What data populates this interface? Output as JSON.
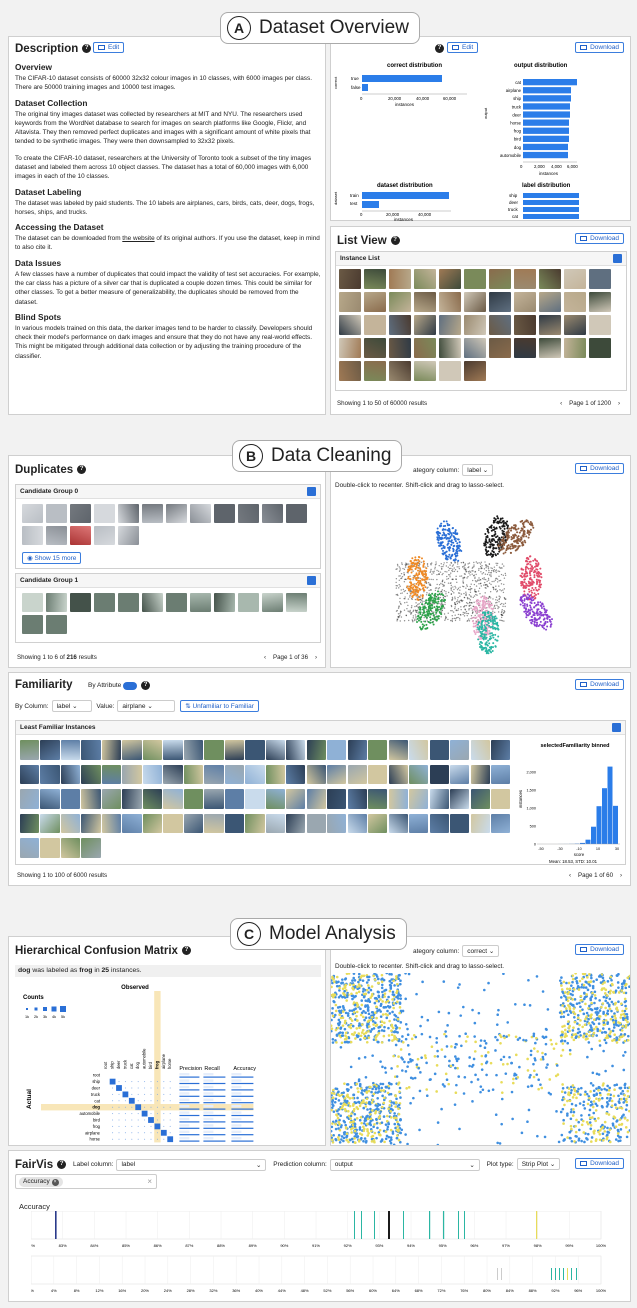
{
  "sections": {
    "a": {
      "letter": "A",
      "title": "Dataset Overview"
    },
    "b": {
      "letter": "B",
      "title": "Data Cleaning"
    },
    "c": {
      "letter": "C",
      "title": "Model Analysis"
    }
  },
  "common": {
    "edit": "Edit",
    "download": "Download",
    "help": "?"
  },
  "description": {
    "title": "Description",
    "overview_h": "Overview",
    "overview": "The CIFAR-10 dataset consists of 60000 32x32 colour images in 10 classes, with 6000 images per class. There are 50000 training images and 10000 test images.",
    "collection_h": "Dataset Collection",
    "collection1": "The original tiny images dataset was collected by researchers at MIT and NYU. The researchers used keywords from the WordNet database to search for images on search platforms like Google, Flickr, and Altavista. They then removed perfect duplicates and images with a significant amount of white pixels that tended to be synthetic images. They were then downsampled to 32x32 pixels.",
    "collection2": "To create the CIFAR-10 dataset, researchers at the University of Toronto took a subset of the tiny images dataset and labeled them across 10 object classes. The dataset has a total of 60,000 images with 6,000 images in each of the 10 classes.",
    "labeling_h": "Dataset Labeling",
    "labeling": "The dataset was labeled by paid students. The 10 labels are airplanes, cars, birds, cats, deer, dogs, frogs, horses, ships, and trucks.",
    "access_h": "Accessing the Dataset",
    "access_pre": "The dataset can be downloaded from ",
    "access_link": "the website",
    "access_post": " of its original authors. If you use the dataset, keep in mind to also cite it.",
    "issues_h": "Data Issues",
    "issues": "A few classes have a number of duplicates that could impact the validity of test set accuracies. For example, the car class has a picture of a silver car that is duplicated a couple dozen times. This could be similar for other classes. To get a better measure of generalizability, the duplicates should be removed from the dataset.",
    "blind_h": "Blind Spots",
    "blind": "In various models trained on this data, the darker images tend to be harder to classify. Developers should check their model's performance on dark images and ensure that they do not have any real-world effects. This might be mitigated through additional data collection or by adjusting the training procedure of the classifier."
  },
  "dist": {
    "c1": {
      "title": "correct distribution",
      "ylabel": "correct",
      "xlabel": "instances",
      "cats": [
        "true",
        "false"
      ],
      "ticks": [
        "0",
        "20,000",
        "40,000",
        "60,000"
      ]
    },
    "c2": {
      "title": "output distribution",
      "ylabel": "output",
      "xlabel": "instances",
      "cats": [
        "cat",
        "airplane",
        "ship",
        "truck",
        "deer",
        "horse",
        "frog",
        "bird",
        "dog",
        "automobile"
      ],
      "ticks": [
        "0",
        "2,000",
        "4,000",
        "6,000"
      ]
    },
    "c3": {
      "title": "dataset distribution",
      "ylabel": "dataset",
      "xlabel": "instances",
      "cats": [
        "train",
        "test"
      ],
      "ticks": [
        "0",
        "20,000",
        "40,000"
      ]
    },
    "c4": {
      "title": "label distribution",
      "cats": [
        "ship",
        "deer",
        "truck",
        "cat"
      ]
    }
  },
  "listview": {
    "title": "List View",
    "sub": "Instance List",
    "footer": "Showing 1 to 50 of 60000 results",
    "page": "Page 1 of 1200",
    "prev": "‹",
    "next": "›"
  },
  "duplicates": {
    "title": "Duplicates",
    "g0": "Candidate Group 0",
    "g1": "Candidate Group 1",
    "more": "Show 15 more",
    "footer_pre": "Showing 1 to 6 of ",
    "footer_bold": "216",
    "footer_post": " results",
    "page": "Page 1 of 36"
  },
  "scatter1": {
    "cat_label": "ategory column:",
    "cat_value": "label",
    "hint": "Double-click to recenter. Shift-click and drag to lasso-select."
  },
  "familiarity": {
    "title": "Familiarity",
    "by_attr": "By Attribute",
    "by_col": "By Column:",
    "col_val": "label",
    "value_lbl": "Value:",
    "value": "airplane",
    "btn": "Unfamiliar to Familiar",
    "sub": "Least Familiar Instances",
    "footer": "Showing 1 to 100 of 6000 results",
    "page": "Page 1 of 60",
    "hist_title": "selectedFamiliarity binned",
    "hist_x": "score",
    "hist_y": "instances",
    "hist_stat": "Mean: 18.53, STD: 10.01",
    "hist_xt": [
      "-50",
      "-30",
      "-10",
      "10",
      "30"
    ],
    "hist_yt": [
      "0",
      "500",
      "1,000",
      "1,500",
      "2,000"
    ]
  },
  "confusion": {
    "title": "Hierarchical Confusion Matrix",
    "caption_a": "dog",
    "caption_b": " was labeled as ",
    "caption_c": "frog",
    "caption_d": " in ",
    "caption_e": "25",
    "caption_f": " instances.",
    "counts": "Counts",
    "count_ticks": [
      "1k",
      "2k",
      "3k",
      "4k",
      "5k"
    ],
    "observed": "Observed",
    "actual": "Actual",
    "prec": "Precision",
    "recall": "Recall",
    "acc": "Accuracy",
    "rows": [
      "root",
      "ship",
      "deer",
      "truck",
      "cat",
      "dog",
      "automobile",
      "bird",
      "frog",
      "airplane",
      "horse"
    ],
    "cols": [
      "root",
      "ship",
      "deer",
      "truck",
      "cat",
      "dog",
      "automobile",
      "bird",
      "frog",
      "airplane",
      "horse"
    ]
  },
  "scatter2": {
    "cat_label": "ategory column:",
    "cat_value": "correct",
    "hint": "Double-click to recenter. Shift-click and drag to lasso-select."
  },
  "fairvis": {
    "title": "FairVis",
    "label_col": "Label column:",
    "label_val": "label",
    "pred_col": "Prediction column:",
    "pred_val": "output",
    "plot_type": "Plot type:",
    "plot_val": "Strip Plot",
    "chip": "Accuracy",
    "metric": "Accuracy",
    "ticks1": [
      "82%",
      "83%",
      "84%",
      "85%",
      "86%",
      "87%",
      "88%",
      "89%",
      "90%",
      "91%",
      "92%",
      "93%",
      "94%",
      "95%",
      "96%",
      "97%",
      "98%",
      "99%",
      "100%"
    ],
    "ticks2": [
      "0%",
      "4%",
      "8%",
      "12%",
      "16%",
      "20%",
      "24%",
      "28%",
      "32%",
      "36%",
      "40%",
      "44%",
      "48%",
      "52%",
      "56%",
      "60%",
      "64%",
      "68%",
      "72%",
      "76%",
      "80%",
      "84%",
      "88%",
      "92%",
      "96%",
      "100%"
    ]
  },
  "colors": {
    "accent": "#2a6fd6",
    "bar": "#2b7de9",
    "yellow": "#e8dc5a",
    "blue": "#3f8fe0"
  }
}
